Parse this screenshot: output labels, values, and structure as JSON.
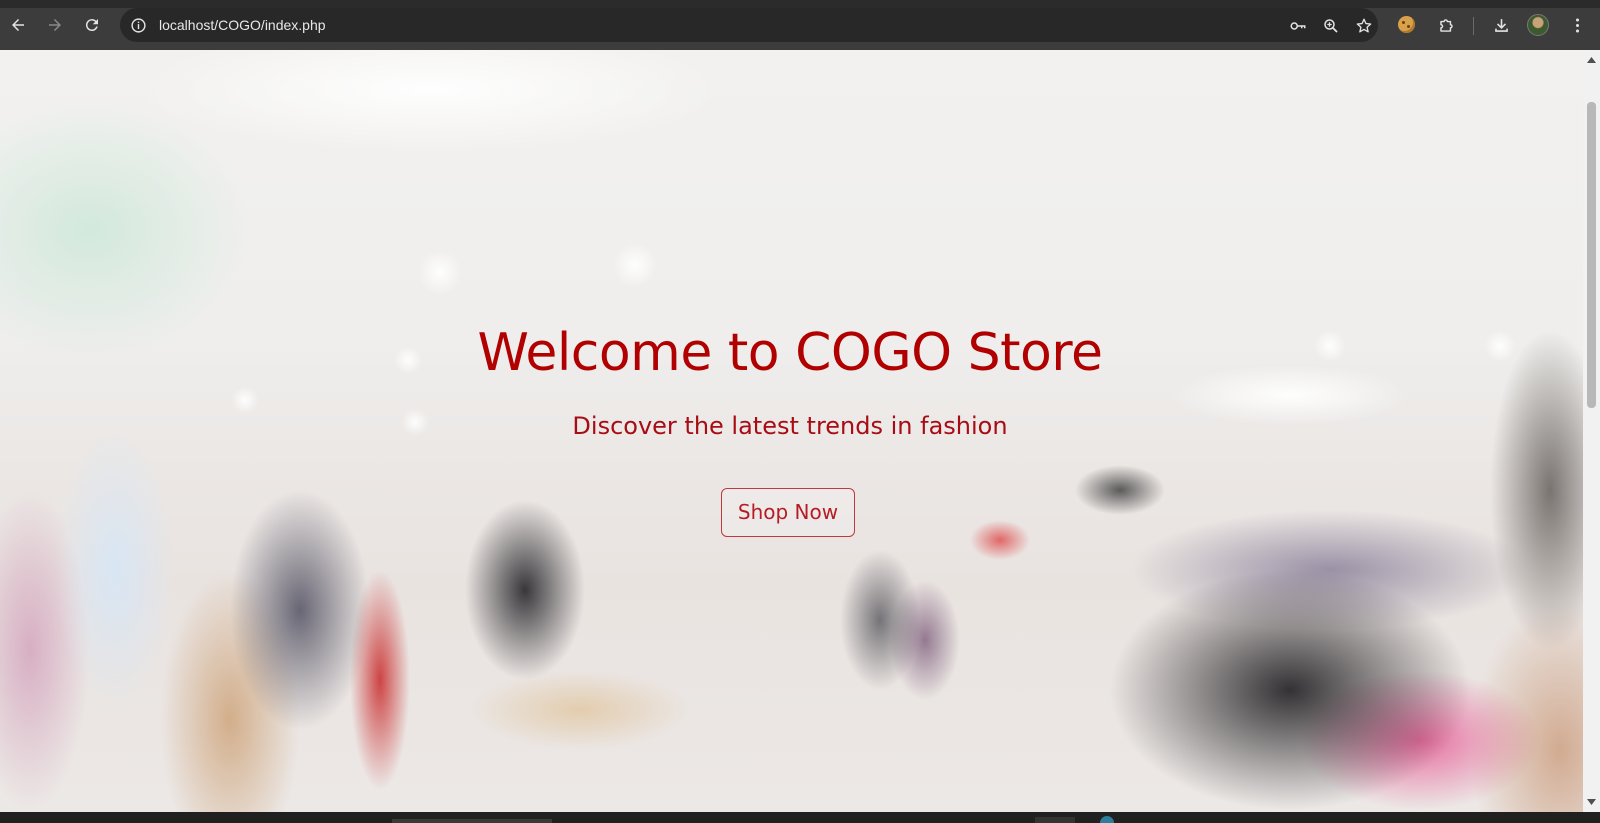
{
  "browser": {
    "url": "localhost/COGO/index.php",
    "icons": {
      "back": "back-arrow-icon",
      "forward": "forward-arrow-icon",
      "reload": "reload-icon",
      "site_info": "info-icon",
      "password": "key-icon",
      "zoom": "zoom-icon",
      "bookmark": "star-icon",
      "cookie_extension": "cookie-icon",
      "extensions": "puzzle-icon",
      "downloads": "download-icon",
      "profile": "avatar",
      "menu": "kebab-menu-icon"
    }
  },
  "hero": {
    "title": "Welcome to COGO Store",
    "subtitle": "Discover the latest trends in fashion",
    "cta_label": "Shop Now"
  },
  "colors": {
    "accent": "#b00000",
    "chrome_bg": "#3c3c3c",
    "address_bg": "#282828"
  }
}
